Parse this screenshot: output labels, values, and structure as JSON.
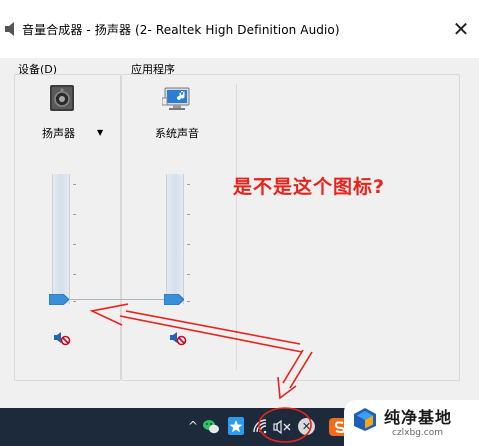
{
  "window": {
    "title": "音量合成器 - 扬声器 (2- Realtek High Definition Audio)",
    "close_glyph": "✕"
  },
  "device_section": {
    "label": "设备(D)",
    "label_main": "设备(",
    "label_mnemonic": "D",
    "label_close": ")",
    "channel": {
      "name": "扬声器",
      "icon": "speaker-device-icon",
      "dropdown_glyph": "▼",
      "mute_icon": "speaker-muted-icon",
      "volume_percent": 0
    }
  },
  "apps_section": {
    "label": "应用程序",
    "channels": [
      {
        "name": "系统声音",
        "icon": "system-sounds-icon",
        "mute_icon": "speaker-muted-icon",
        "volume_percent": 0
      }
    ]
  },
  "annotation": {
    "text": "是不是这个图标?",
    "color": "#e8231b"
  },
  "taskbar": {
    "chevron_glyph": "^",
    "icons": [
      "wechat-icon",
      "star-app-icon",
      "wifi-icon",
      "speaker-muted-tray-icon",
      "close-circle-icon",
      "sohu-input-icon"
    ],
    "close_circle_glyph": "✕"
  },
  "watermark": {
    "title": "纯净基地",
    "url": "czlxbg.com"
  },
  "colors": {
    "taskbar_bg": "#1d2a3b",
    "mixer_bg": "#f0f0f0",
    "accent_thumb": "#3a8fd9",
    "annotation_red": "#e8231b"
  }
}
